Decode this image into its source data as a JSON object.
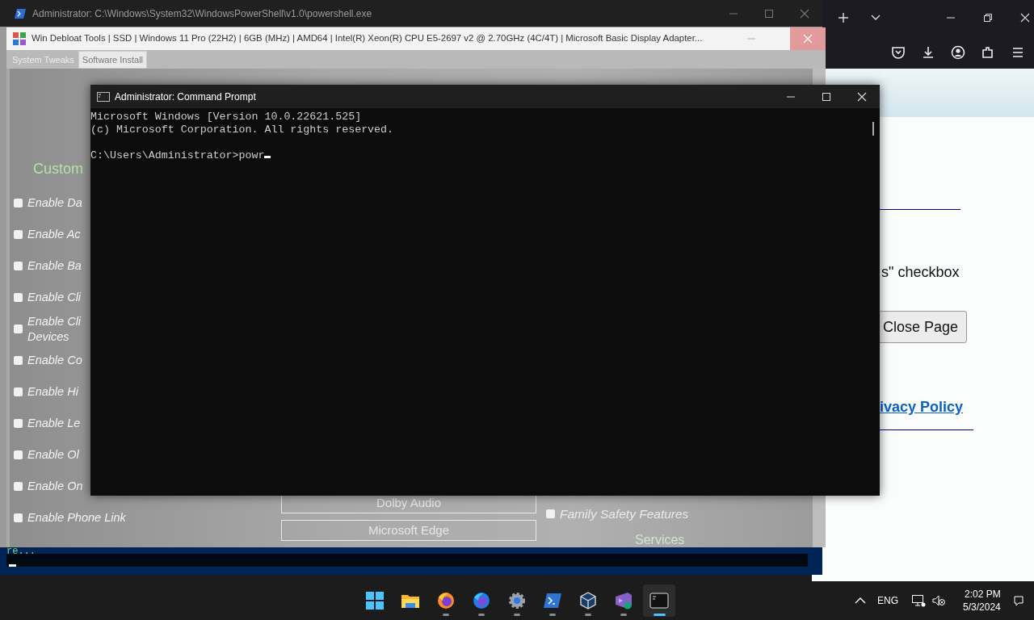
{
  "powershell_window": {
    "title": "Administrator: C:\\Windows\\System32\\WindowsPowerShell\\v1.0\\powershell.exe",
    "console_tail": "re..."
  },
  "debloat_window": {
    "title": "Win Debloat Tools | SSD | Windows 11 Pro (22H2) | 6GB (MHz) | AMD64 | Intel(R) Xeon(R) CPU E5-2697 v2 @ 2.70GHz (4C/4T) | Microsoft Basic Display Adapter...",
    "tabs": [
      {
        "label": "System Tweaks",
        "selected": true
      },
      {
        "label": "Software Install",
        "selected": false
      }
    ],
    "left_section": {
      "heading": "Custom",
      "options": [
        {
          "label": "Enable Da",
          "checked": false
        },
        {
          "label": "Enable Ac",
          "checked": false
        },
        {
          "label": "Enable Ba",
          "checked": false
        },
        {
          "label": "Enable Cli",
          "checked": false
        },
        {
          "label": "Enable Cli Devices",
          "checked": false
        },
        {
          "label": "Enable Co",
          "checked": false
        },
        {
          "label": "Enable Hi",
          "checked": false
        },
        {
          "label": "Enable Le",
          "checked": false
        },
        {
          "label": "Enable Ol",
          "checked": false
        },
        {
          "label": "Enable On",
          "checked": false
        },
        {
          "label": "Enable Phone Link",
          "checked": false
        }
      ]
    },
    "buttons": [
      "Dolby Audio",
      "Microsoft Edge"
    ],
    "right_section": {
      "options": [
        {
          "label": "Family Safety Features",
          "checked": false
        }
      ],
      "heading": "Services"
    }
  },
  "command_prompt": {
    "title": "Administrator: Command Prompt",
    "output": [
      "Microsoft Windows [Version 10.0.22621.525]",
      "(c) Microsoft Corporation. All rights reserved."
    ],
    "prompt": "C:\\Users\\Administrator>powr"
  },
  "browser": {
    "text": "s\" checkbox",
    "button": "Close Page",
    "link": "ivacy Policy"
  },
  "taskbar": {
    "apps": [
      {
        "running": false,
        "selected": false
      },
      {
        "running": false,
        "selected": false
      },
      {
        "running": true,
        "selected": false
      },
      {
        "running": true,
        "selected": false
      },
      {
        "running": true,
        "selected": false
      },
      {
        "running": true,
        "selected": false
      },
      {
        "running": true,
        "selected": false
      },
      {
        "running": true,
        "selected": false
      },
      {
        "running": true,
        "selected": true
      }
    ],
    "language": "ENG",
    "time": "2:02 PM",
    "date": "5/3/2024"
  }
}
